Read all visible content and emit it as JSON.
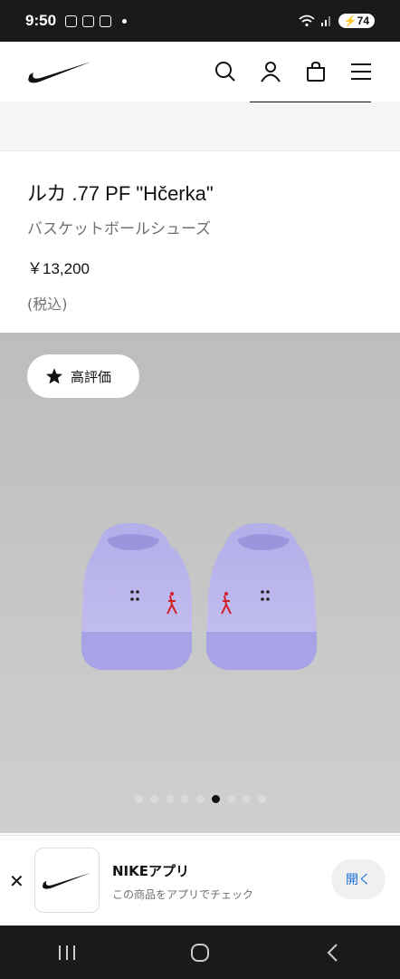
{
  "status_bar": {
    "time": "9:50",
    "battery": "74"
  },
  "header": {
    "logo_icon": "nike-swoosh-icon",
    "icons": [
      "search-icon",
      "user-icon",
      "bag-icon",
      "menu-icon"
    ]
  },
  "product": {
    "name": "ルカ .77 PF \"Hčerka\"",
    "category": "バスケットボールシューズ",
    "price": "￥13,200",
    "tax_note": "(税込)"
  },
  "gallery": {
    "badge_label": "高評価",
    "badge_icon": "star-icon",
    "total_images": 9,
    "active_index": 5
  },
  "app_banner": {
    "title": "NIKEアプリ",
    "subtitle": "この商品をアプリでチェック",
    "open_label": "開く"
  },
  "colors": {
    "shoe": "#bcb7e8",
    "accent_blue": "#1a6fdc",
    "jumpman_red": "#d0202a"
  }
}
